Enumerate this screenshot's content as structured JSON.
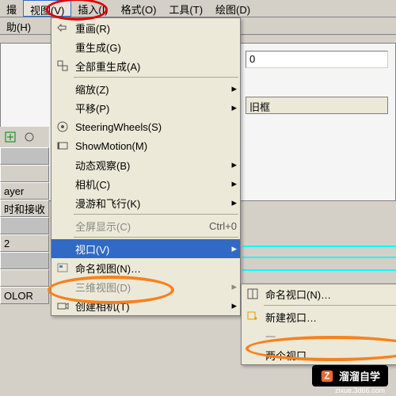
{
  "menubar": {
    "items": [
      "撮",
      "视图(V)",
      "插入(I)",
      "格式(O)",
      "工具(T)",
      "绘图(D)"
    ],
    "extra_row": "助(H)"
  },
  "view_menu": {
    "items": [
      {
        "icon": "redraw",
        "label": "重画(R)"
      },
      {
        "icon": "",
        "label": "重生成(G)"
      },
      {
        "icon": "regen-all",
        "label": "全部重生成(A)"
      },
      {
        "sep": true
      },
      {
        "icon": "",
        "label": "缩放(Z)",
        "arrow": true
      },
      {
        "icon": "",
        "label": "平移(P)",
        "arrow": true
      },
      {
        "icon": "wheel",
        "label": "SteeringWheels(S)"
      },
      {
        "icon": "motion",
        "label": "ShowMotion(M)"
      },
      {
        "icon": "",
        "label": "动态观察(B)",
        "arrow": true
      },
      {
        "icon": "",
        "label": "相机(C)",
        "arrow": true
      },
      {
        "icon": "",
        "label": "漫游和飞行(K)",
        "arrow": true
      },
      {
        "sep": true
      },
      {
        "icon": "",
        "label": "全屏显示(C)",
        "shortcut": "Ctrl+0",
        "disabled": true
      },
      {
        "sep": true
      },
      {
        "icon": "",
        "label": "视口(V)",
        "arrow": true,
        "highlighted": true
      },
      {
        "icon": "named-view",
        "label": "命名视图(N)…"
      },
      {
        "icon": "",
        "label": "三维视图(D)",
        "arrow": true,
        "disabled": true
      },
      {
        "icon": "camera",
        "label": "创建相机(T)",
        "arrow": true
      }
    ]
  },
  "viewport_submenu": {
    "items": [
      {
        "icon": "named-vp",
        "label": "命名视口(N)…"
      },
      {
        "sep": true
      },
      {
        "icon": "new-vp",
        "label": "新建视口…"
      },
      {
        "icon": "",
        "label": "一",
        "disabled": true
      },
      {
        "icon": "",
        "label": "两个视口…"
      }
    ]
  },
  "bg": {
    "input1": "0",
    "input2": "旧框"
  },
  "left_panel": {
    "rows": [
      "",
      "",
      "ayer",
      "时和接收",
      "",
      "2",
      "",
      "",
      "OLOR"
    ]
  },
  "watermark": {
    "text": "溜溜自学",
    "url": "zixue.3d66.com"
  }
}
